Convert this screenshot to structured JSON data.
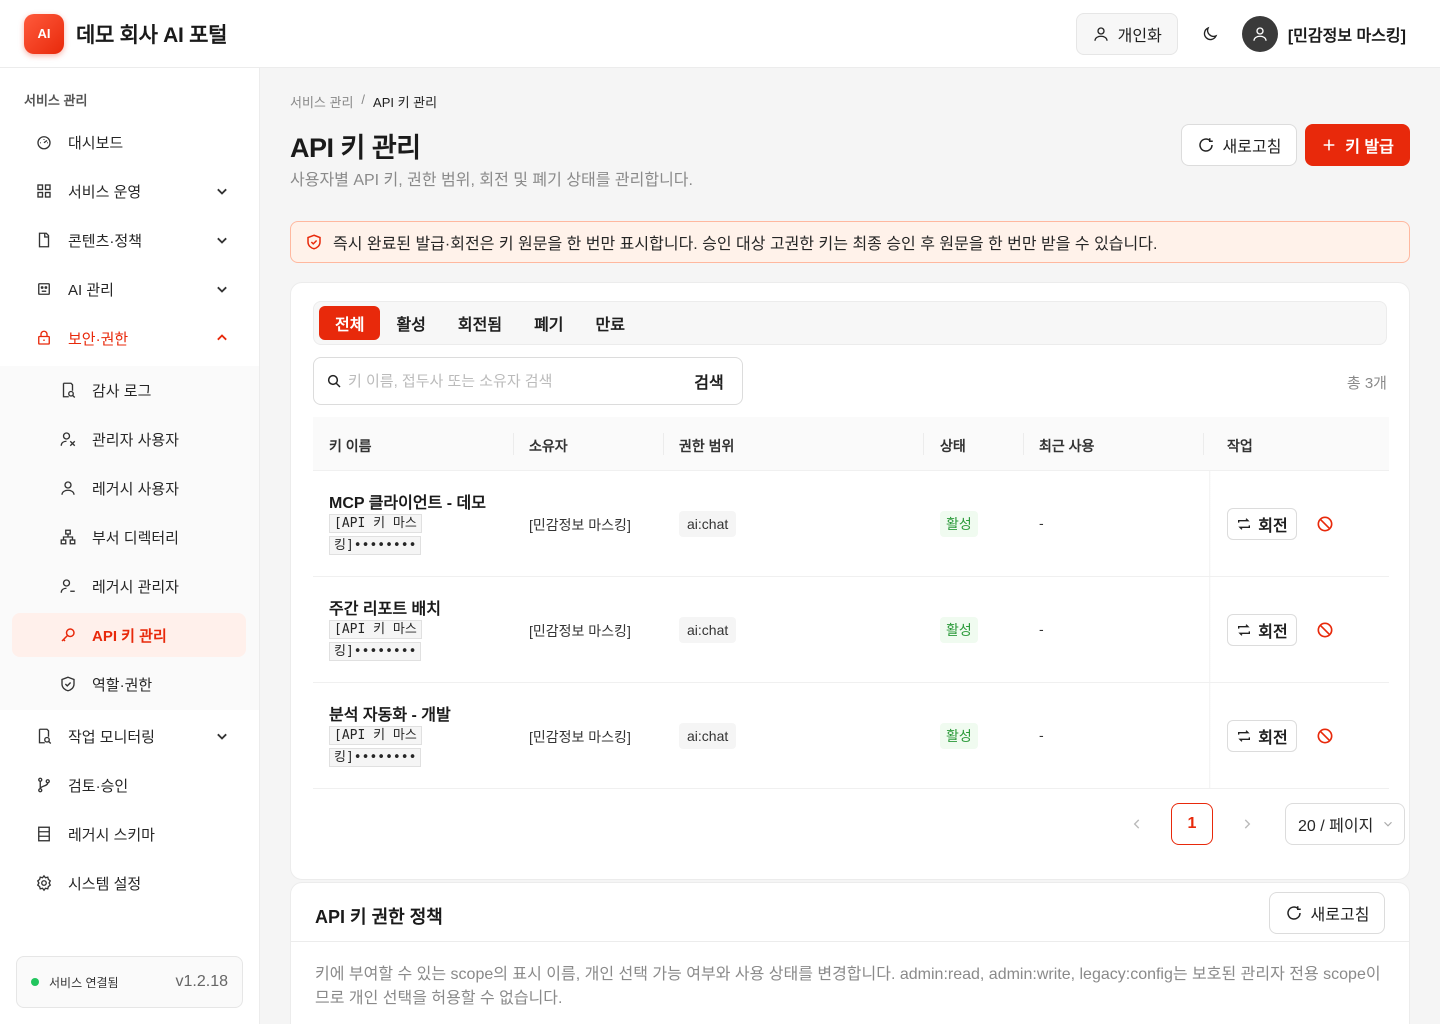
{
  "header": {
    "logo": "AI",
    "title": "데모 회사 AI 포털",
    "personal_label": "개인화",
    "user_name": "[민감정보 마스킹]"
  },
  "sidebar": {
    "section_label": "서비스 관리",
    "items": [
      {
        "label": "대시보드",
        "icon": "dashboard-icon"
      },
      {
        "label": "서비스 운영",
        "icon": "grid-icon"
      },
      {
        "label": "콘텐츠·정책",
        "icon": "document-icon"
      },
      {
        "label": "AI 관리",
        "icon": "robot-icon"
      },
      {
        "label": "보안·권한",
        "icon": "lock-icon"
      }
    ],
    "sub_items": [
      {
        "label": "감사 로그",
        "icon": "audit-log-icon"
      },
      {
        "label": "관리자 사용자",
        "icon": "admin-user-icon"
      },
      {
        "label": "레거시 사용자",
        "icon": "user-icon"
      },
      {
        "label": "부서 디렉터리",
        "icon": "org-tree-icon"
      },
      {
        "label": "레거시 관리자",
        "icon": "user-settings-icon"
      },
      {
        "label": "API 키 관리",
        "icon": "key-icon"
      },
      {
        "label": "역할·권한",
        "icon": "shield-icon"
      }
    ],
    "bottom_items": [
      {
        "label": "작업 모니터링",
        "icon": "monitor-icon"
      },
      {
        "label": "검토·승인",
        "icon": "branch-icon"
      },
      {
        "label": "레거시 스키마",
        "icon": "schema-icon"
      },
      {
        "label": "시스템 설정",
        "icon": "gear-icon"
      }
    ],
    "status": {
      "text": "서비스 연결됨",
      "version": "v1.2.18"
    }
  },
  "main": {
    "breadcrumb": {
      "parent": "서비스 관리",
      "separator": "/",
      "current": "API 키 관리"
    },
    "title": "API 키 관리",
    "description": "사용자별 API 키, 권한 범위, 회전 및 폐기 상태를 관리합니다.",
    "refresh_label": "새로고침",
    "issue_label": "키 발급",
    "alert": "즉시 완료된 발급·회전은 키 원문을 한 번만 표시합니다. 승인 대상 고권한 키는 최종 승인 후 원문을 한 번만 받을 수 있습니다.",
    "tabs": [
      "전체",
      "활성",
      "회전됨",
      "폐기",
      "만료"
    ],
    "search": {
      "placeholder": "키 이름, 접두사 또는 소유자 검색",
      "button": "검색"
    },
    "total": "총 3개",
    "table": {
      "headers": [
        "키 이름",
        "소유자",
        "권한 범위",
        "상태",
        "최근 사용",
        "작업"
      ],
      "rotate_label": "회전",
      "rows": [
        {
          "name": "MCP 클라이언트 - 데모",
          "mask": "[API 키 마스킹]••••••••",
          "owner": "[민감정보 마스킹]",
          "scope": "ai:chat",
          "state": "활성",
          "last_used": "-"
        },
        {
          "name": "주간 리포트 배치",
          "mask": "[API 키 마스킹]••••••••",
          "owner": "[민감정보 마스킹]",
          "scope": "ai:chat",
          "state": "활성",
          "last_used": "-"
        },
        {
          "name": "분석 자동화 - 개발",
          "mask": "[API 키 마스킹]••••••••",
          "owner": "[민감정보 마스킹]",
          "scope": "ai:chat",
          "state": "활성",
          "last_used": "-"
        }
      ]
    },
    "pagination": {
      "page": "1",
      "page_size": "20 / 페이지"
    },
    "policy": {
      "title": "API 키 권한 정책",
      "refresh_label": "새로고침",
      "description": "키에 부여할 수 있는 scope의 표시 이름, 개인 선택 가능 여부와 사용 상태를 변경합니다. admin:read, admin:write, legacy:config는 보호된 관리자 전용 scope이므로 개인 선택을 허용할 수 없습니다."
    }
  },
  "colors": {
    "accent": "#e8290b",
    "success": "#2b9a3a",
    "alert_bg": "#fff2ea"
  }
}
